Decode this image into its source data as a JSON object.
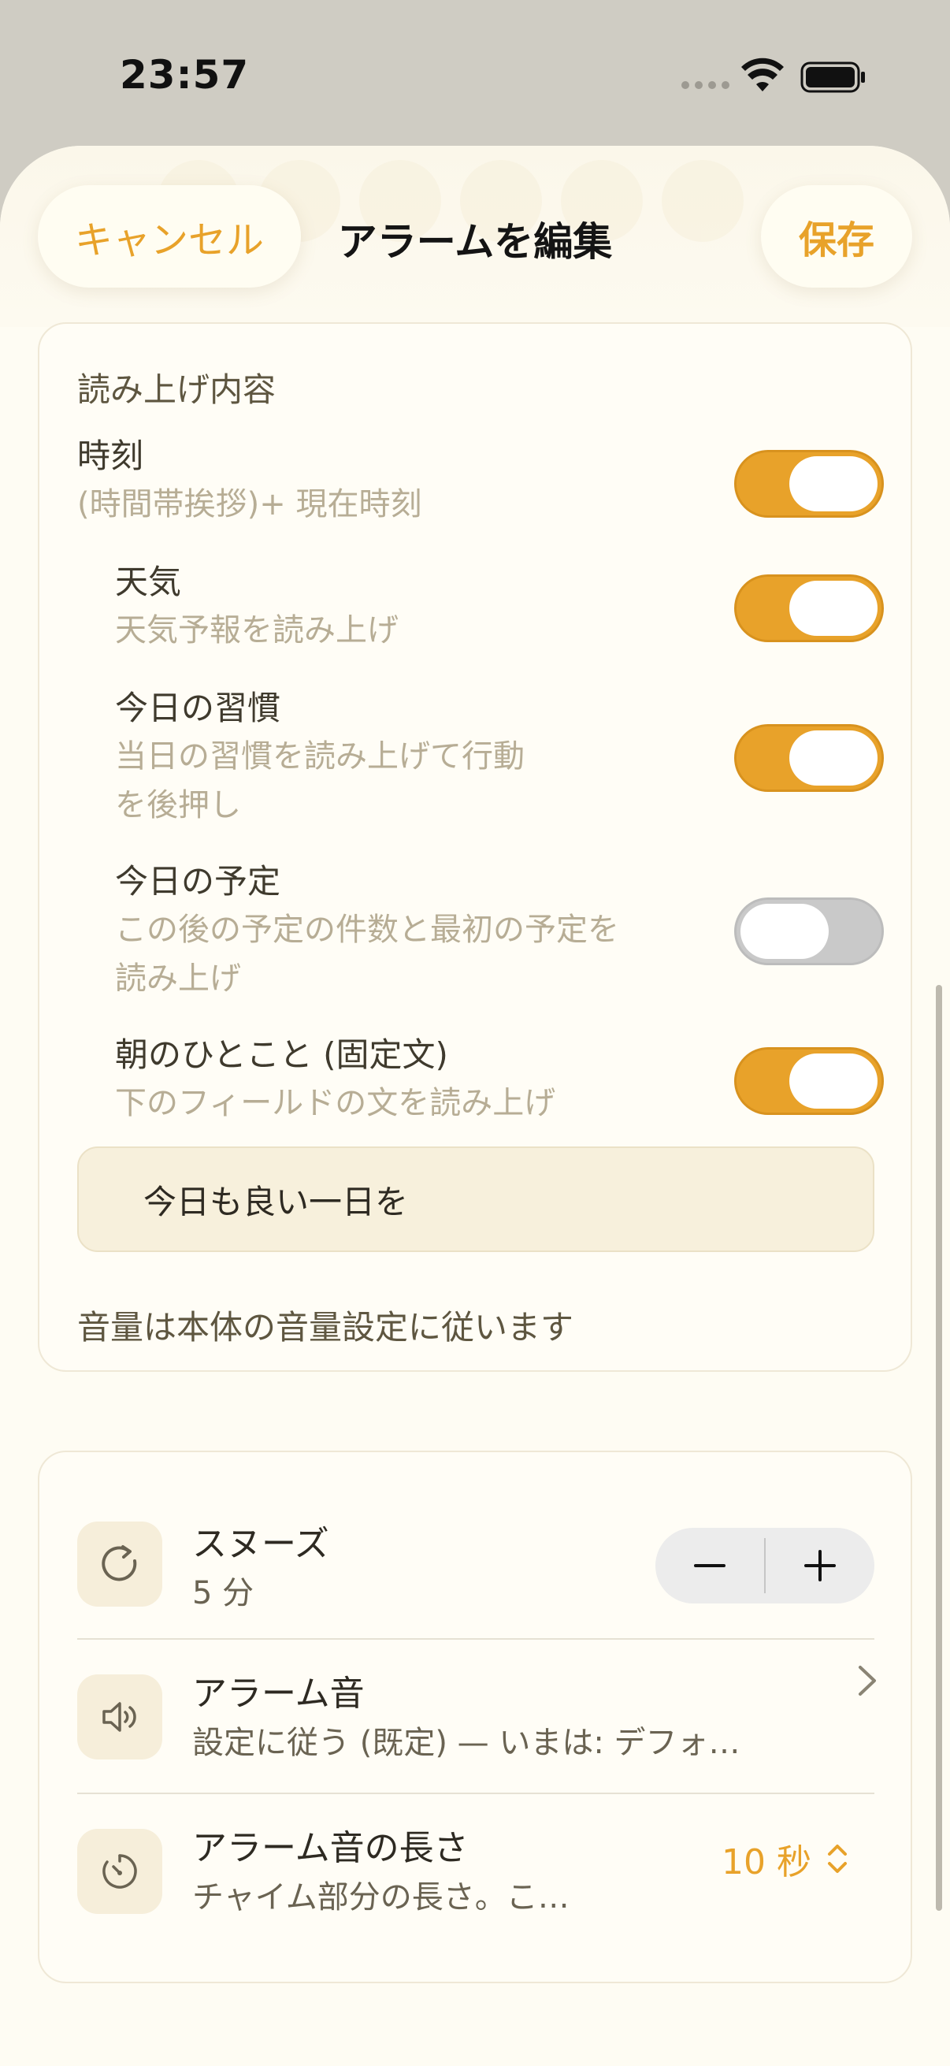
{
  "status_bar": {
    "time": "23:57"
  },
  "nav": {
    "cancel_label": "キャンセル",
    "title": "アラームを編集",
    "save_label": "保存"
  },
  "read_section": {
    "title": "読み上げ内容",
    "items": [
      {
        "label": "時刻",
        "sub": "(時間帯挨拶)+ 現在時刻",
        "on": true
      },
      {
        "label": "天気",
        "sub": "天気予報を読み上げ",
        "on": true
      },
      {
        "label": "今日の習慣",
        "sub_line1": "当日の習慣を読み上げて行動",
        "sub_line2": "を後押し",
        "on": true
      },
      {
        "label": "今日の予定",
        "sub_line1": "この後の予定の件数と最初の予定を",
        "sub_line2": "読み上げ",
        "on": false
      },
      {
        "label": "朝のひとこと (固定文)",
        "sub": "下のフィールドの文を読み上げ",
        "on": true
      }
    ],
    "phrase_value": "今日も良い一日を",
    "volume_note": "音量は本体の音量設定に従います"
  },
  "settings": {
    "snooze": {
      "title": "スヌーズ",
      "value": "5 分",
      "minus": "−",
      "plus": "+"
    },
    "alarm_sound": {
      "title": "アラーム音",
      "detail": "設定に従う (既定) — いまは: デフォ…"
    },
    "sound_length": {
      "title": "アラーム音の長さ",
      "detail": "チャイム部分の長さ。こ…",
      "value": "10 秒"
    }
  },
  "colors": {
    "accent": "#e8a22a",
    "sheet_bg": "#fefcf3",
    "backdrop": "#cfccc3"
  },
  "icons": [
    "wifi-icon",
    "battery-icon",
    "refresh-icon",
    "speaker-icon",
    "timer-icon",
    "chevron-right-icon",
    "chevron-updown-icon"
  ]
}
